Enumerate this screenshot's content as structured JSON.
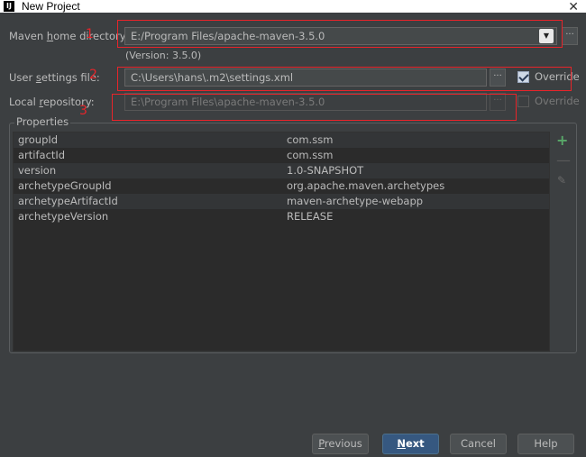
{
  "window": {
    "title": "New Project",
    "app_icon_text": "IJ",
    "close_glyph": "✕"
  },
  "maven": {
    "home_label_pre": "Maven ",
    "home_label_mn": "h",
    "home_label_post": "ome directory:",
    "home_value": "E:/Program Files/apache-maven-3.5.0",
    "version_text": "(Version: 3.5.0)",
    "settings_label_pre": "User ",
    "settings_label_mn": "s",
    "settings_label_post": "ettings file:",
    "settings_value": "C:\\Users\\hans\\.m2\\settings.xml",
    "settings_override_label": "Override",
    "settings_override_checked": true,
    "repo_label_pre": "Local ",
    "repo_label_mn": "r",
    "repo_label_post": "epository:",
    "repo_value": "E:\\Program Files\\apache-maven-3.5.0",
    "repo_override_label": "Override",
    "repo_override_checked": false,
    "browse_glyph": "···",
    "dropdown_glyph": "▼"
  },
  "annotations": [
    "1",
    "2",
    "3"
  ],
  "properties": {
    "title": "Properties",
    "rows": [
      {
        "key": "groupId",
        "value": "com.ssm"
      },
      {
        "key": "artifactId",
        "value": "com.ssm"
      },
      {
        "key": "version",
        "value": "1.0-SNAPSHOT"
      },
      {
        "key": "archetypeGroupId",
        "value": "org.apache.maven.archetypes"
      },
      {
        "key": "archetypeArtifactId",
        "value": "maven-archetype-webapp"
      },
      {
        "key": "archetypeVersion",
        "value": "RELEASE"
      }
    ],
    "tools": {
      "add": "+",
      "remove": "—",
      "edit": "✎"
    }
  },
  "buttons": {
    "previous_mn": "P",
    "previous_rest": "revious",
    "next_mn": "N",
    "next_rest": "ext",
    "cancel": "Cancel",
    "help": "Help"
  },
  "colors": {
    "annotation": "#e8242a",
    "primary_button": "#365880",
    "add_icon": "#59a869"
  }
}
